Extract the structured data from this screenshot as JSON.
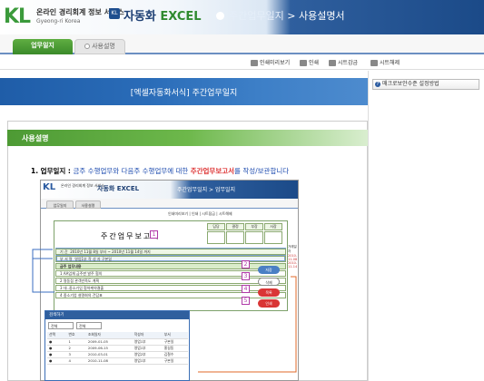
{
  "header": {
    "logo_mark": "KL",
    "logo_tagline": "온라인 경리회계 정보 서비스",
    "logo_subtagline": "Gyeong-ri Korea",
    "brand_badge": "KL",
    "brand_prefix": "자동화 ",
    "brand_highlight": "EXCEL",
    "breadcrumb_parent": "주간업무일지",
    "breadcrumb_sep": " > ",
    "breadcrumb_current": "사용설명서"
  },
  "tabs": {
    "active": "업무일지",
    "inactive": "사용설명"
  },
  "toolbar": {
    "preview": "인쇄미리보기",
    "print": "인쇄",
    "enlarge": "시트감금",
    "sheet_release": "시트해제"
  },
  "main": {
    "banner_title": "[엑셀자동화서식] 주간업무일지",
    "section_title": "사용설명",
    "q1_label": "1. 업무일지 : ",
    "q1_text": "금주 수행업무와 다음주 수행업무에 대한 ",
    "q1_highlight": "주간업무보고서",
    "q1_tail": "를 작성/보관합니다"
  },
  "right_panel": {
    "help_icon": "?",
    "help_button": "매크로보안수준 설정방법"
  },
  "inner": {
    "logo_mark": "KL",
    "logo_tagline": "온라인 경리회계 정보 서비스",
    "brand": "자동화 EXCEL",
    "title": "주간업무일지 > 업무일지",
    "tab1": "업무일지",
    "tab2": "사용설명",
    "toolbar": "인쇄미리보기 | 인쇄 | 시트잠금 | 시트해제",
    "doc_title": "주간업무보고서",
    "sign_cells": [
      "담당",
      "결정",
      "부장",
      "사장"
    ],
    "rows": [
      {
        "label": "기 간",
        "value": "2010년 11월 8일 부터 ~ 2010년 11월 14일 까지"
      },
      {
        "label": "부 서 명",
        "value": "영업1부    작 성 자    구본일"
      },
      {
        "label": "금주 업무내용",
        "value": ""
      },
      {
        "label": "1",
        "value": "AA업체 금주판 발주 협의"
      },
      {
        "label": "2",
        "value": "명동점 관객만족도 계획"
      },
      {
        "label": "3",
        "value": "대..중소기업 협약계약결출"
      },
      {
        "label": "4",
        "value": "중소기업 설명회의 건답표"
      }
    ],
    "side_dates": [
      "2010-11-08",
      "2010-11-14"
    ],
    "side_labels": [
      "거래일자",
      "부서",
      "성명"
    ],
    "numbers": [
      "1",
      "2",
      "3",
      "4",
      "5"
    ],
    "action_buttons": [
      "저장",
      "삭제",
      "목록",
      "인쇄"
    ]
  },
  "popup": {
    "title": "검색하기",
    "filter1": "전체",
    "filter2": "전체",
    "columns": [
      "선택",
      "번호",
      "조회일자",
      "작성자",
      "부서"
    ],
    "rows": [
      [
        "1",
        "2009-01-05",
        "2009-01-11",
        "영업1부",
        "구본일"
      ],
      [
        "2",
        "2009-06-15",
        "2009-06-21",
        "영업1부",
        "홍길동"
      ],
      [
        "3",
        "2010-03-01",
        "2010-03-07",
        "영업2부",
        "김철수"
      ],
      [
        "4",
        "2010-11-08",
        "2010-11-14",
        "영업1부",
        "구본일"
      ]
    ]
  }
}
